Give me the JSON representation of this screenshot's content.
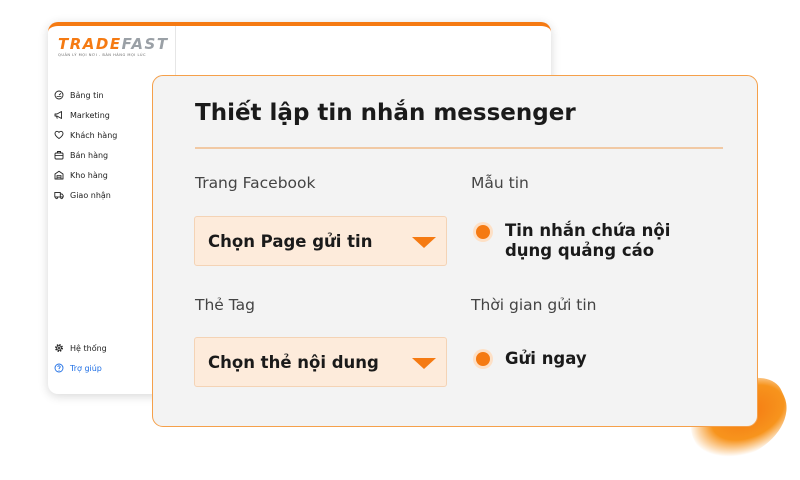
{
  "brand": {
    "logo_part1": "TRADE",
    "logo_part2": "FAST",
    "tagline": "QUẢN LÝ MỌI NƠI - BÁN HÀNG MỌI LÚC"
  },
  "sidebar": {
    "items": [
      {
        "label": "Bảng tin",
        "icon": "dashboard-icon"
      },
      {
        "label": "Marketing",
        "icon": "megaphone-icon"
      },
      {
        "label": "Khách hàng",
        "icon": "customer-icon"
      },
      {
        "label": "Bán hàng",
        "icon": "sales-icon"
      },
      {
        "label": "Kho hàng",
        "icon": "warehouse-icon"
      },
      {
        "label": "Giao nhận",
        "icon": "delivery-icon"
      }
    ],
    "bottom": [
      {
        "label": "Hệ thống",
        "icon": "gear-icon"
      },
      {
        "label": "Trợ giúp",
        "icon": "help-icon"
      }
    ]
  },
  "card": {
    "title": "Thiết lập tin nhắn messenger",
    "facebook_page_label": "Trang Facebook",
    "facebook_page_value": "Chọn Page gửi tin",
    "template_label": "Mẫu tin",
    "template_value_line1": "Tin nhắn chứa nội",
    "template_value_line2": "dụng quảng cáo",
    "tag_label": "Thẻ Tag",
    "tag_value": "Chọn thẻ nội dung",
    "send_time_label": "Thời gian gửi tin",
    "send_time_value": "Gửi ngay"
  },
  "colors": {
    "accent": "#f57a12",
    "card_border": "#f5a04a",
    "select_bg": "#fdebdb",
    "help_link": "#1f6fe5"
  }
}
